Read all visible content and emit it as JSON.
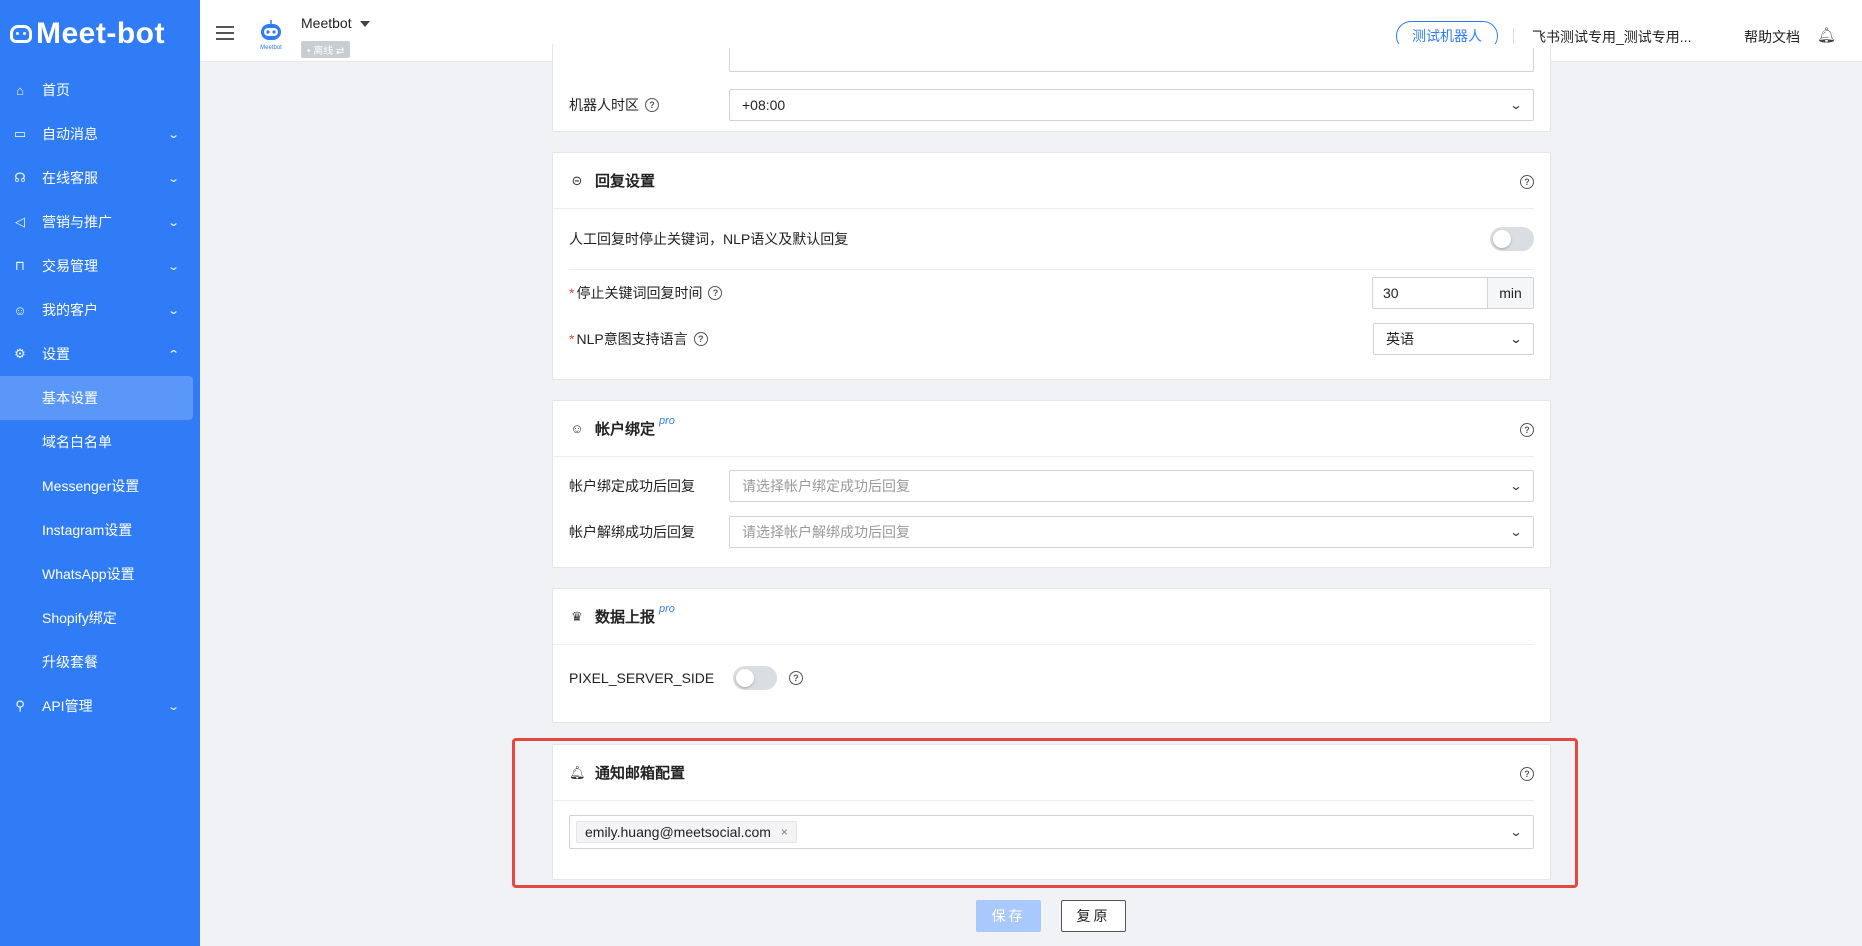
{
  "brand": {
    "logo_text": "Meet-bot"
  },
  "sidebar": {
    "items": [
      {
        "label": "首页",
        "icon": "home-icon"
      },
      {
        "label": "自动消息",
        "icon": "message-icon"
      },
      {
        "label": "在线客服",
        "icon": "headset-icon"
      },
      {
        "label": "营销与推广",
        "icon": "megaphone-icon"
      },
      {
        "label": "交易管理",
        "icon": "bag-icon"
      },
      {
        "label": "我的客户",
        "icon": "user-icon"
      },
      {
        "label": "设置",
        "icon": "gear-icon"
      },
      {
        "label": "API管理",
        "icon": "plug-icon"
      }
    ],
    "settings_sub": [
      "基本设置",
      "域名白名单",
      "Messenger设置",
      "Instagram设置",
      "WhatsApp设置",
      "Shopify绑定",
      "升级套餐"
    ],
    "active_sub": "基本设置"
  },
  "header": {
    "bot_name": "Meetbot",
    "bot_status": "• 离线 ⇄",
    "avatar_caption": "Meetbot",
    "test_button": "测试机器人",
    "org_name": "飞书测试专用_测试专用...",
    "help": "帮助文档"
  },
  "basic": {
    "timezone_label": "机器人时区",
    "timezone_value": "+08:00"
  },
  "reply": {
    "title": "回复设置",
    "stop_label": "人工回复时停止关键词，NLP语义及默认回复",
    "stop_enabled": false,
    "stop_time_label": "停止关键词回复时间",
    "stop_time_value": "30",
    "stop_time_unit": "min",
    "nlp_lang_label": "NLP意图支持语言",
    "nlp_lang_value": "英语"
  },
  "account": {
    "title": "帐户绑定",
    "pro": "pro",
    "bind_label": "帐户绑定成功后回复",
    "bind_placeholder": "请选择帐户绑定成功后回复",
    "unbind_label": "帐户解绑成功后回复",
    "unbind_placeholder": "请选择帐户解绑成功后回复"
  },
  "report": {
    "title": "数据上报",
    "pro": "pro",
    "pixel_label": "PIXEL_SERVER_SIDE",
    "pixel_enabled": false
  },
  "notify": {
    "title": "通知邮箱配置",
    "emails": [
      "emily.huang@meetsocial.com"
    ],
    "remove_glyph": "×"
  },
  "actions": {
    "save": "保存",
    "reset": "复原"
  },
  "colors": {
    "accent": "#2f7cf6",
    "highlight": "#e5483f"
  }
}
